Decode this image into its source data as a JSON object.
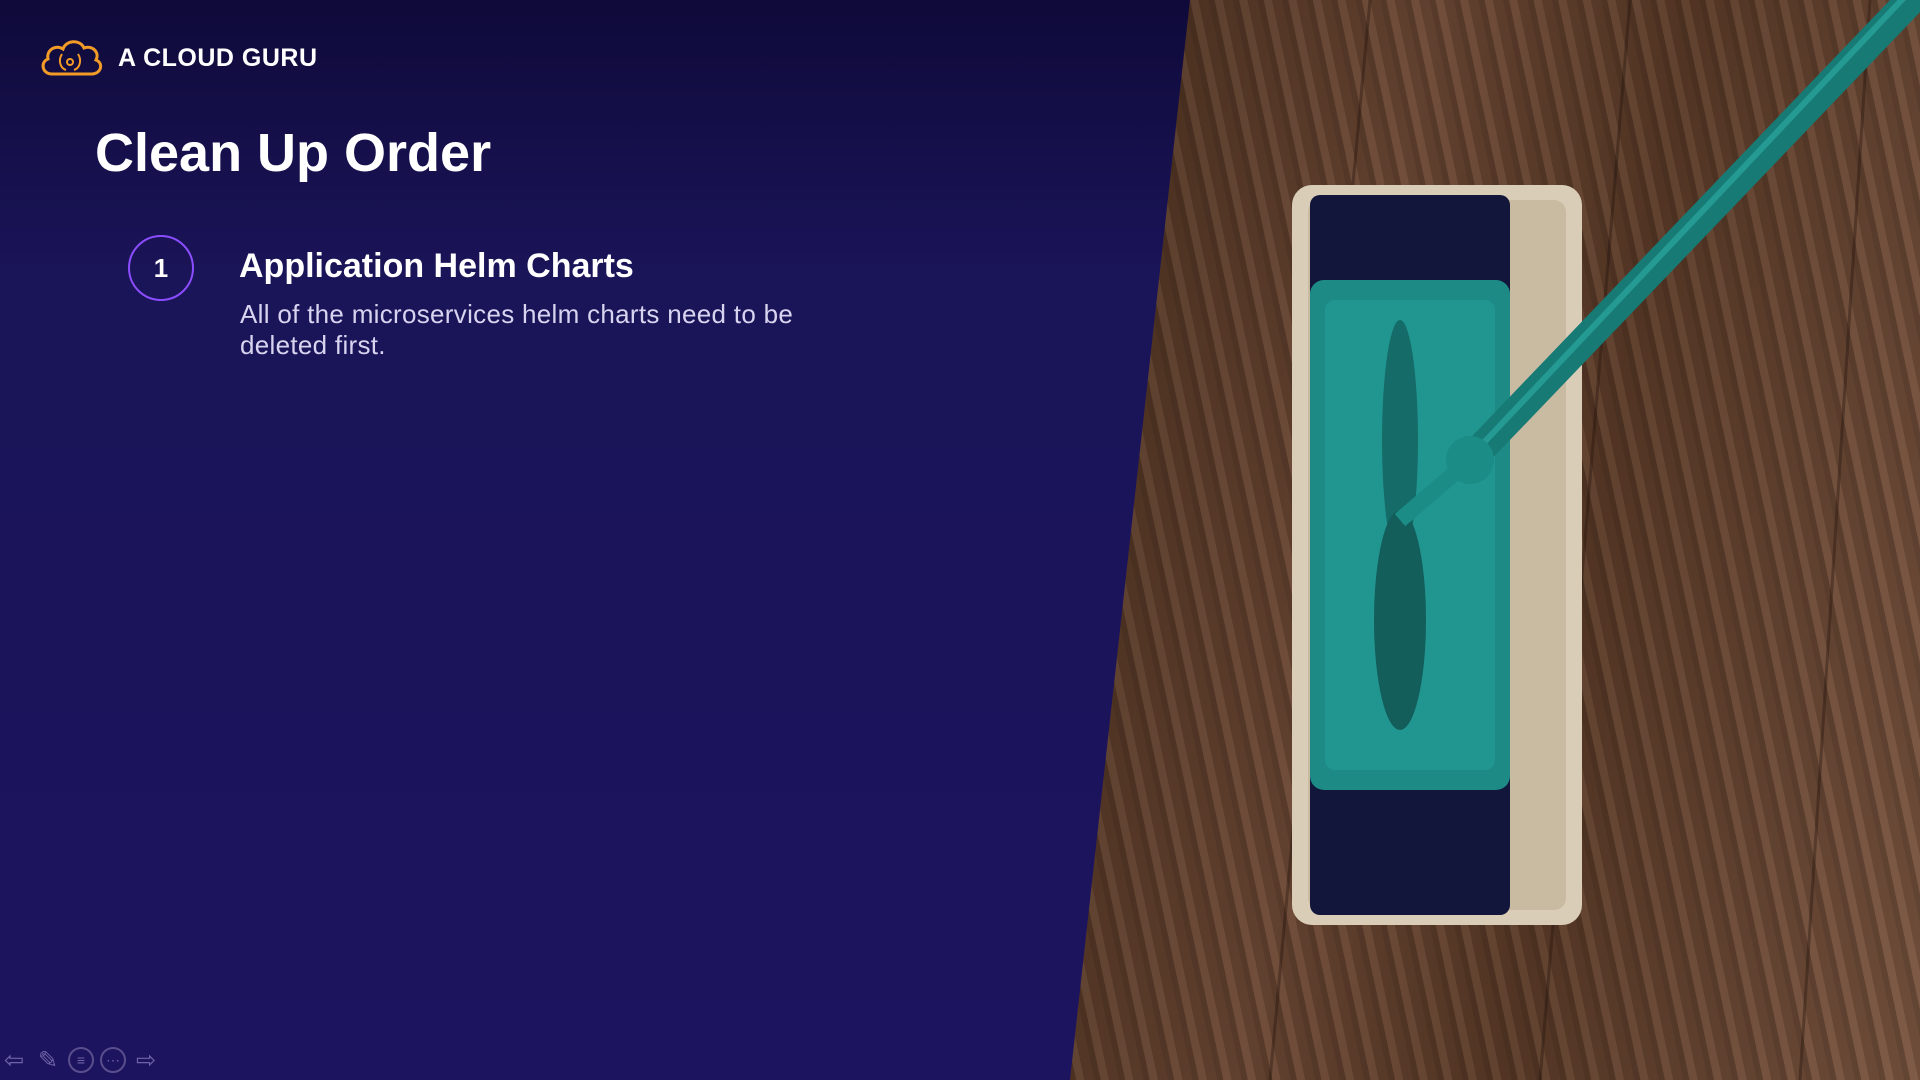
{
  "brand": {
    "name": "A CLOUD GURU",
    "accent": "#f29b26"
  },
  "slide": {
    "title": "Clean Up Order",
    "steps": [
      {
        "number": "1",
        "title": "Application Helm Charts",
        "description": "All of the microservices helm charts need to be deleted first."
      }
    ]
  },
  "photo": {
    "subject": "mop-on-wood-floor"
  },
  "controls": {
    "icons": [
      "prev-arrow-icon",
      "pen-icon",
      "menu-icon",
      "more-icon",
      "next-arrow-icon"
    ],
    "prev_glyph": "⇦",
    "pen_glyph": "✎",
    "menu_glyph": "≡",
    "more_glyph": "⋯",
    "next_glyph": "⇨"
  },
  "colors": {
    "background": "#1c145e",
    "step_ring": "#8a4dff",
    "mop": "#1e8a86"
  }
}
